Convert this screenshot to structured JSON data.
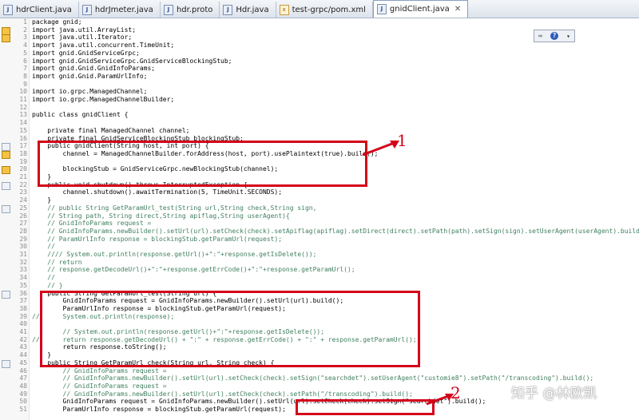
{
  "tabs": [
    {
      "label": "hdrClient.java",
      "kind": "java"
    },
    {
      "label": "hdrJmeter.java",
      "kind": "java"
    },
    {
      "label": "hdr.proto",
      "kind": "file"
    },
    {
      "label": "Hdr.java",
      "kind": "java"
    },
    {
      "label": "test-grpc/pom.xml",
      "kind": "xml"
    },
    {
      "label": "gnidClient.java",
      "kind": "java",
      "active": true
    }
  ],
  "close_glyph": "✕",
  "tool_icons": [
    "keyboard-icon",
    "help-icon",
    "dropdown-icon"
  ],
  "tool_help": "?",
  "tool_arrow": "▾",
  "lines": [
    {
      "n": "1",
      "c": "package gnid;"
    },
    {
      "n": "2",
      "c": "import java.util.ArrayList;",
      "m": "warn"
    },
    {
      "n": "3",
      "c": "import java.util.Iterator;",
      "m": "warn"
    },
    {
      "n": "4",
      "c": "import java.util.concurrent.TimeUnit;"
    },
    {
      "n": "5",
      "c": "import gnid.GnidServiceGrpc;"
    },
    {
      "n": "6",
      "c": "import gnid.GnidServiceGrpc.GnidServiceBlockingStub;"
    },
    {
      "n": "7",
      "c": "import gnid.Gnid.GnidInfoParams;"
    },
    {
      "n": "8",
      "c": "import gnid.Gnid.ParamUrlInfo;"
    },
    {
      "n": "9",
      "c": ""
    },
    {
      "n": "10",
      "c": "import io.grpc.ManagedChannel;"
    },
    {
      "n": "11",
      "c": "import io.grpc.ManagedChannelBuilder;"
    },
    {
      "n": "12",
      "c": ""
    },
    {
      "n": "13",
      "c": "public class gnidClient {"
    },
    {
      "n": "14",
      "c": ""
    },
    {
      "n": "15",
      "c": "    private final ManagedChannel channel;"
    },
    {
      "n": "16",
      "c": "    private final GnidServiceBlockingStub blockingStub;"
    },
    {
      "n": "17",
      "c": "    public gnidClient(String host, int port) {",
      "m": "fold"
    },
    {
      "n": "18",
      "c": "        channel = ManagedChannelBuilder.forAddress(host, port).usePlaintext(true).build();",
      "m": "warn"
    },
    {
      "n": "19",
      "c": ""
    },
    {
      "n": "20",
      "c": "        blockingStub = GnidServiceGrpc.newBlockingStub(channel);",
      "m": "warn"
    },
    {
      "n": "21",
      "c": "    }"
    },
    {
      "n": "22",
      "c": "    public void shutdown() throws InterruptedException {",
      "m": "fold"
    },
    {
      "n": "23",
      "c": "        channel.shutdown().awaitTermination(5, TimeUnit.SECONDS);"
    },
    {
      "n": "24",
      "c": "    }"
    },
    {
      "n": "25",
      "c": "    // public String GetParamUrl_test(String url,String check,String sign,",
      "m": "fold"
    },
    {
      "n": "26",
      "c": "    // String path, String direct,String apiflag,String userAgent){"
    },
    {
      "n": "27",
      "c": "    // GnidInfoParams request ="
    },
    {
      "n": "28",
      "c": "    // GnidInfoParams.newBuilder().setUrl(url).setCheck(check).setApiflag(apiflag).setDirect(direct).setPath(path).setSign(sign).setUserAgent(userAgent).build();"
    },
    {
      "n": "29",
      "c": "    // ParamUrlInfo response = blockingStub.getParamUrl(request);"
    },
    {
      "n": "30",
      "c": "    //"
    },
    {
      "n": "31",
      "c": "    //// System.out.println(response.getUrl()+\":\"+response.getIsDelete());"
    },
    {
      "n": "32",
      "c": "    // return"
    },
    {
      "n": "33",
      "c": "    // response.getDecodeUrl()+\":\"+response.getErrCode()+\":\"+response.getParamUrl();"
    },
    {
      "n": "34",
      "c": "    //"
    },
    {
      "n": "35",
      "c": "    // }"
    },
    {
      "n": "36",
      "c": "    public String GetParamUrl_test(String url) {",
      "m": "fold"
    },
    {
      "n": "37",
      "c": "        GnidInfoParams request = GnidInfoParams.newBuilder().setUrl(url).build();"
    },
    {
      "n": "38",
      "c": "        ParamUrlInfo response = blockingStub.getParamUrl(request);"
    },
    {
      "n": "39",
      "c": "//      System.out.println(response);"
    },
    {
      "n": "40",
      "c": ""
    },
    {
      "n": "41",
      "c": "        // System.out.println(response.getUrl()+\":\"+response.getIsDelete());"
    },
    {
      "n": "42",
      "c": "//      return response.getDecodeUrl() + \":\" + response.getErrCode() + \":\" + response.getParamUrl();"
    },
    {
      "n": "43",
      "c": "        return response.toString();"
    },
    {
      "n": "44",
      "c": "    }"
    },
    {
      "n": "45",
      "c": "    public String GetParamUrl_check(String url, String check) {",
      "m": "fold"
    },
    {
      "n": "46",
      "c": "        // GnidInfoParams request ="
    },
    {
      "n": "47",
      "c": "        // GnidInfoParams.newBuilder().setUrl(url).setCheck(check).setSign(\"searchdet\").setUserAgent(\"customie8\").setPath(\"/transcoding\").build();"
    },
    {
      "n": "48",
      "c": "        // GnidInfoParams request ="
    },
    {
      "n": "49",
      "c": "        // GnidInfoParams.newBuilder().setUrl(url).setCheck(check).setPath(\"/transcoding\").build();"
    },
    {
      "n": "50",
      "c": "        GnidInfoParams request = GnidInfoParams.newBuilder().setUrl(url).setCheck(check).setSign(\"searchdet\").build();"
    },
    {
      "n": "51",
      "c": "        ParamUrlInfo response = blockingStub.getParamUrl(request);"
    }
  ],
  "annotations": {
    "callout_1": "1",
    "callout_2": "2"
  },
  "watermark": "知乎 @林欧凯"
}
